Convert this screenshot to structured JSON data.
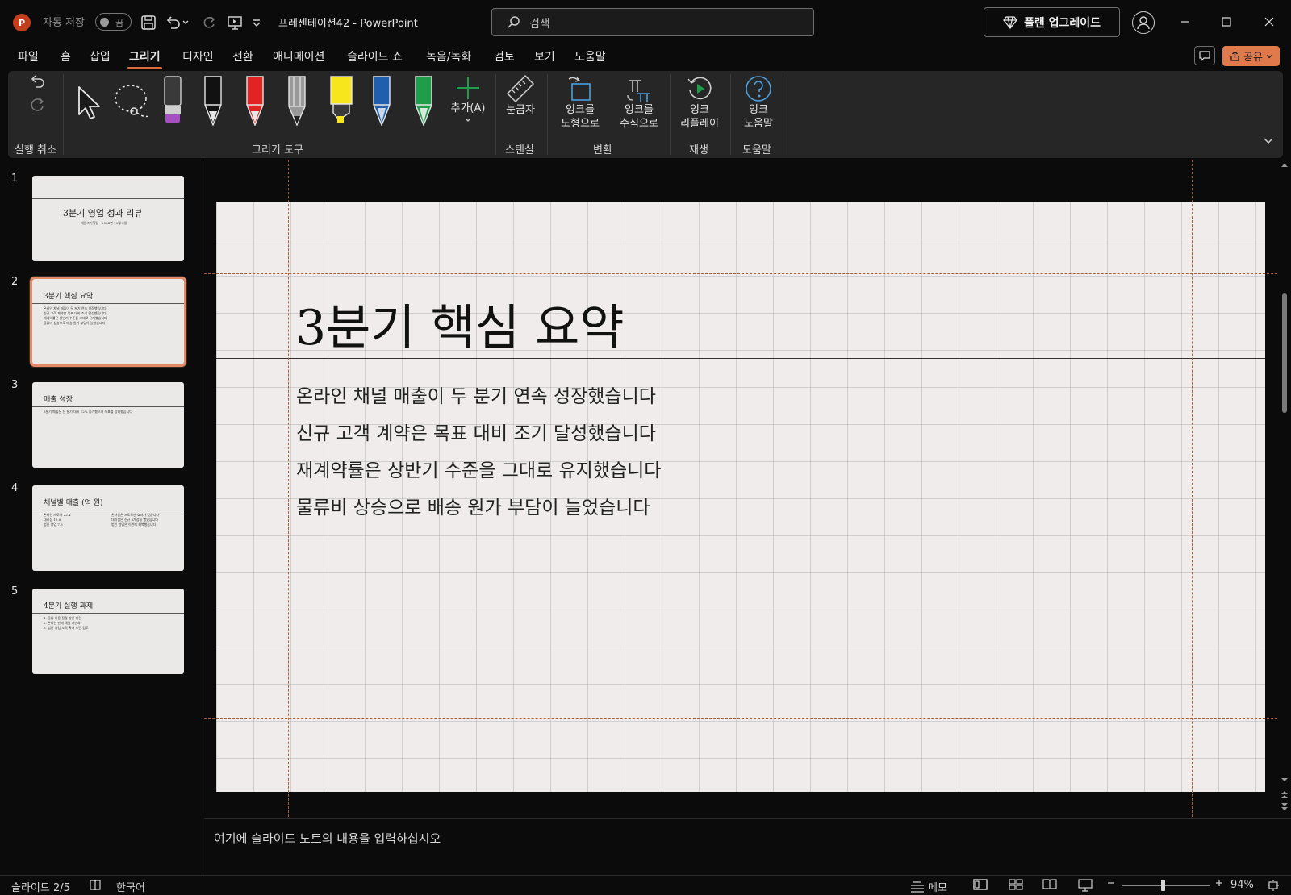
{
  "titlebar": {
    "logo_letter": "P",
    "autosave_label": "자동 저장",
    "autosave_state": "끔",
    "doc_title": "프레젠테이션42  -  PowerPoint",
    "search_placeholder": "검색",
    "upgrade_label": "플랜 업그레이드"
  },
  "menu": {
    "tabs": [
      "파일",
      "홈",
      "삽입",
      "그리기",
      "디자인",
      "전환",
      "애니메이션",
      "슬라이드 쇼",
      "녹음/녹화",
      "검토",
      "보기",
      "도움말"
    ],
    "active_tab": "그리기",
    "share_label": "공유"
  },
  "ribbon": {
    "groups": {
      "undo": "실행 취소",
      "draw_tools": "그리기 도구",
      "stencil": "스텐실",
      "convert": "변환",
      "replay": "재생",
      "help": "도움말"
    },
    "buttons": {
      "add": "추가(A)",
      "ruler": "눈금자",
      "ink_to_shape": "잉크를\n도형으로",
      "ink_to_math": "잉크를\n수식으로",
      "ink_replay": "잉크\n리플레이",
      "ink_help": "잉크\n도움말"
    },
    "pen_colors": {
      "eraser": "#a64fc2",
      "black": "#111111",
      "red": "#e02424",
      "pencil": "#9a9a9a",
      "highlighter": "#f7e61c",
      "blue": "#1f5fae",
      "green": "#1e9e4a"
    }
  },
  "thumbnails": [
    {
      "num": "1",
      "title": "3분기 영업 성과 리뷰",
      "body": "세일즈기획팀 · 2024년 10월 8일"
    },
    {
      "num": "2",
      "title": "3분기 핵심 요약",
      "body": "온라인 채널 매출이 두 분기 연속 성장했습니다\n신규 고객 계약은 목표 대비 조기 달성했습니다\n재계약률은 상반기 수준을 그대로 유지했습니다\n물류비 상승으로 배송 원가 부담이 늘었습니다"
    },
    {
      "num": "3",
      "title": "매출 성장",
      "body": "3분기 매출은 전 분기 대비 12% 증가했으며 목표를 상회했습니다"
    },
    {
      "num": "4",
      "title": "채널별 매출 (억 원)",
      "body": "온라인 스토어 22.4\n대리점 15.8\n법인 영업 7.3",
      "body2": "온라인은 프로모션 효과가 컸습니다\n대리점은 신규 3개점을 열었습니다\n법인 영업은 이번에 회복했습니다"
    },
    {
      "num": "5",
      "title": "4분기 실행 과제",
      "body": "1. 물류 비용 절감 방안 마련\n2. 온라인 판매 채널 다변화\n3. 법인 영업 조직 확대 추진 검토"
    }
  ],
  "selected_slide": 2,
  "slide": {
    "title": "3분기 핵심 요약",
    "bullets": [
      "온라인 채널 매출이 두 분기 연속 성장했습니다",
      "신규 고객 계약은 목표 대비 조기 달성했습니다",
      "재계약률은 상반기 수준을 그대로 유지했습니다",
      "물류비 상승으로 배송 원가 부담이 늘었습니다"
    ]
  },
  "notes_placeholder": "여기에 슬라이드 노트의 내용을 입력하십시오",
  "status": {
    "slide_counter": "슬라이드 2/5",
    "language": "한국어",
    "notes_label": "메모",
    "zoom": "94%",
    "zoom_level": 0.47
  }
}
